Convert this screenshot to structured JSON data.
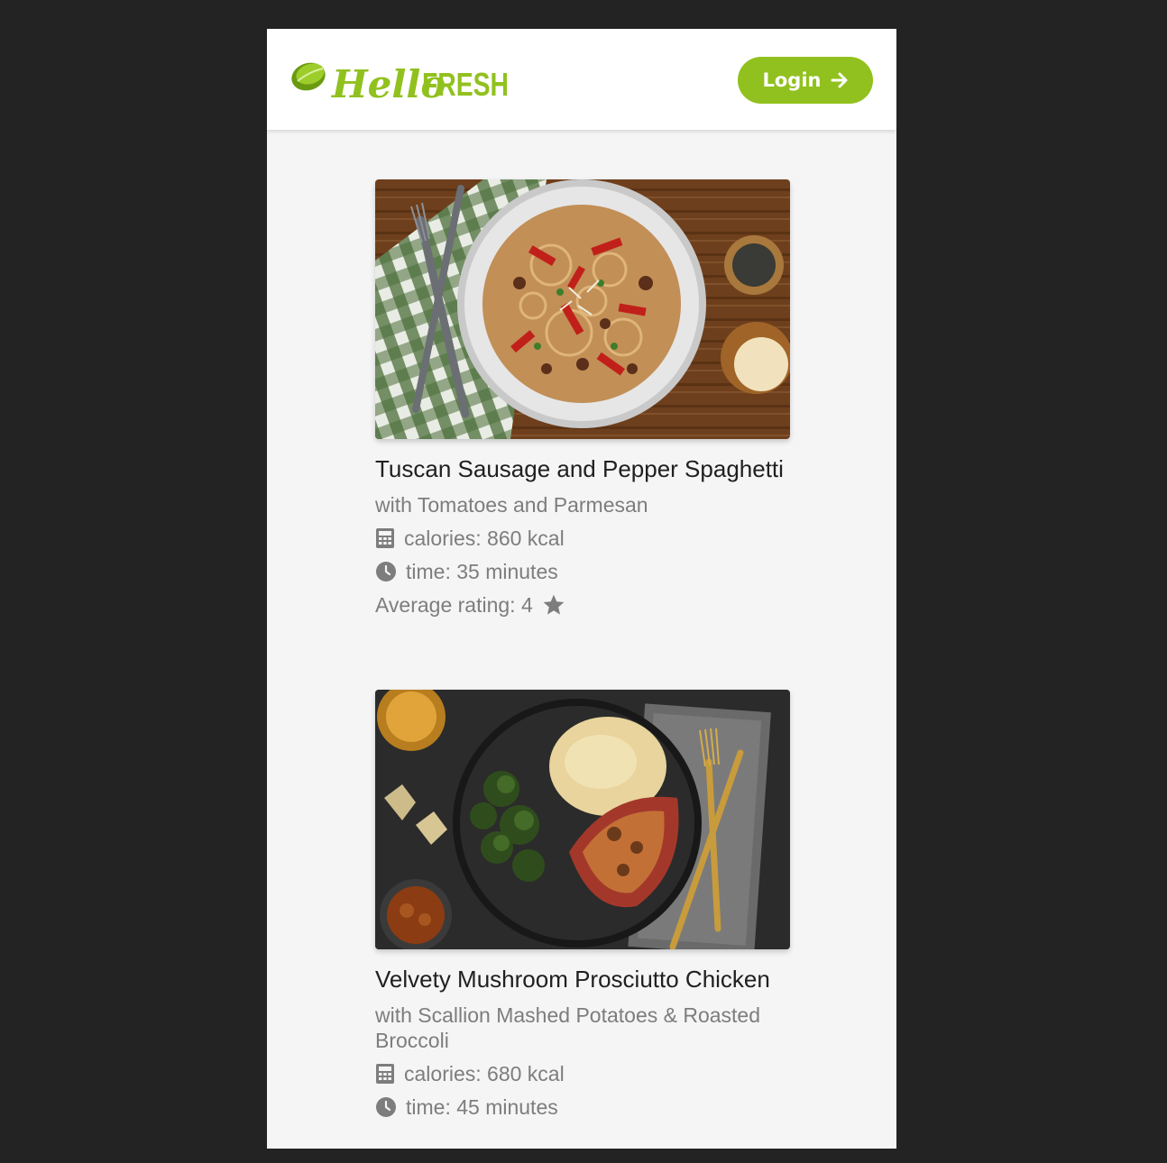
{
  "header": {
    "logo_text_hello": "Hello",
    "logo_text_fresh": "FRESH",
    "login_label": "Login",
    "login_icon": "arrow-right-icon"
  },
  "colors": {
    "brand_green": "#91c11e",
    "page_background": "#f5f5f5",
    "outer_background": "#232323",
    "title_text": "#202020",
    "meta_text": "#7d7d7d"
  },
  "recipes": [
    {
      "title": "Tuscan Sausage and Pepper Spaghetti",
      "subtitle": "with Tomatoes and Parmesan",
      "calories": "calories: 860 kcal",
      "time": "time: 35 minutes",
      "rating": "Average rating: 4",
      "calories_icon": "calculator-icon",
      "time_icon": "clock-icon",
      "rating_icon": "star-icon"
    },
    {
      "title": "Velvety Mushroom Prosciutto Chicken",
      "subtitle": "with Scallion Mashed Potatoes & Roasted Broccoli",
      "calories": "calories: 680 kcal",
      "time": "time: 45 minutes",
      "calories_icon": "calculator-icon",
      "time_icon": "clock-icon"
    }
  ]
}
